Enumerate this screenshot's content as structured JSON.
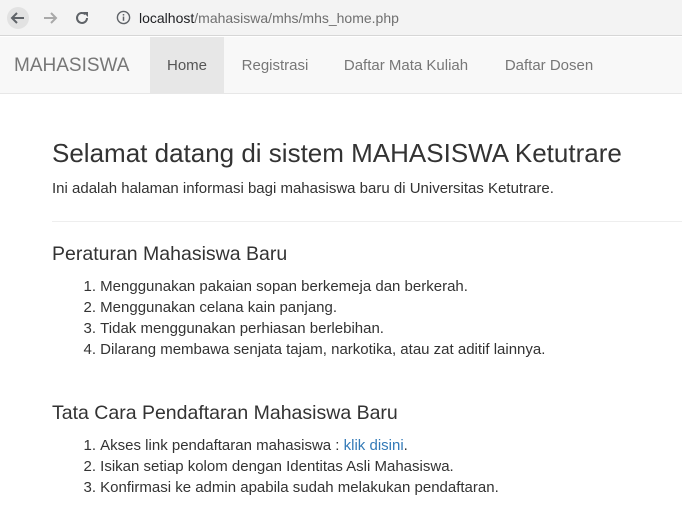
{
  "browser": {
    "url_host": "localhost",
    "url_path": "/mahasiswa/mhs/mhs_home.php"
  },
  "navbar": {
    "brand": "MAHASISWA",
    "items": [
      {
        "label": "Home",
        "active": true
      },
      {
        "label": "Registrasi",
        "active": false
      },
      {
        "label": "Daftar Mata Kuliah",
        "active": false
      },
      {
        "label": "Daftar Dosen",
        "active": false
      }
    ]
  },
  "jumbotron": {
    "title": "Selamat datang di sistem MAHASISWA Ketutrare",
    "lead": "Ini adalah halaman informasi bagi mahasiswa baru di Universitas Ketutrare."
  },
  "rules_section": {
    "title": "Peraturan Mahasiswa Baru",
    "items": [
      {
        "num": "1.",
        "text": "Menggunakan pakaian sopan berkemeja dan berkerah."
      },
      {
        "num": "2.",
        "text": "Menggunakan celana kain panjang."
      },
      {
        "num": "3.",
        "text": "Tidak menggunakan perhiasan berlebihan."
      },
      {
        "num": "4.",
        "text": "Dilarang membawa senjata tajam, narkotika, atau zat aditif lainnya."
      }
    ]
  },
  "registration_section": {
    "title": "Tata Cara Pendaftaran Mahasiswa Baru",
    "items": [
      {
        "num": "1.",
        "text_before": "Akses link pendaftaran mahasiswa : ",
        "link": "klik disini",
        "text_after": "."
      },
      {
        "num": "2.",
        "text": "Isikan setiap kolom dengan Identitas Asli Mahasiswa."
      },
      {
        "num": "3.",
        "text": "Konfirmasi ke admin apabila sudah melakukan pendaftaran."
      }
    ]
  },
  "colors": {
    "link": "#337ab7",
    "navbar_bg": "#f8f8f8",
    "nav_active_bg": "#e7e7e7"
  }
}
